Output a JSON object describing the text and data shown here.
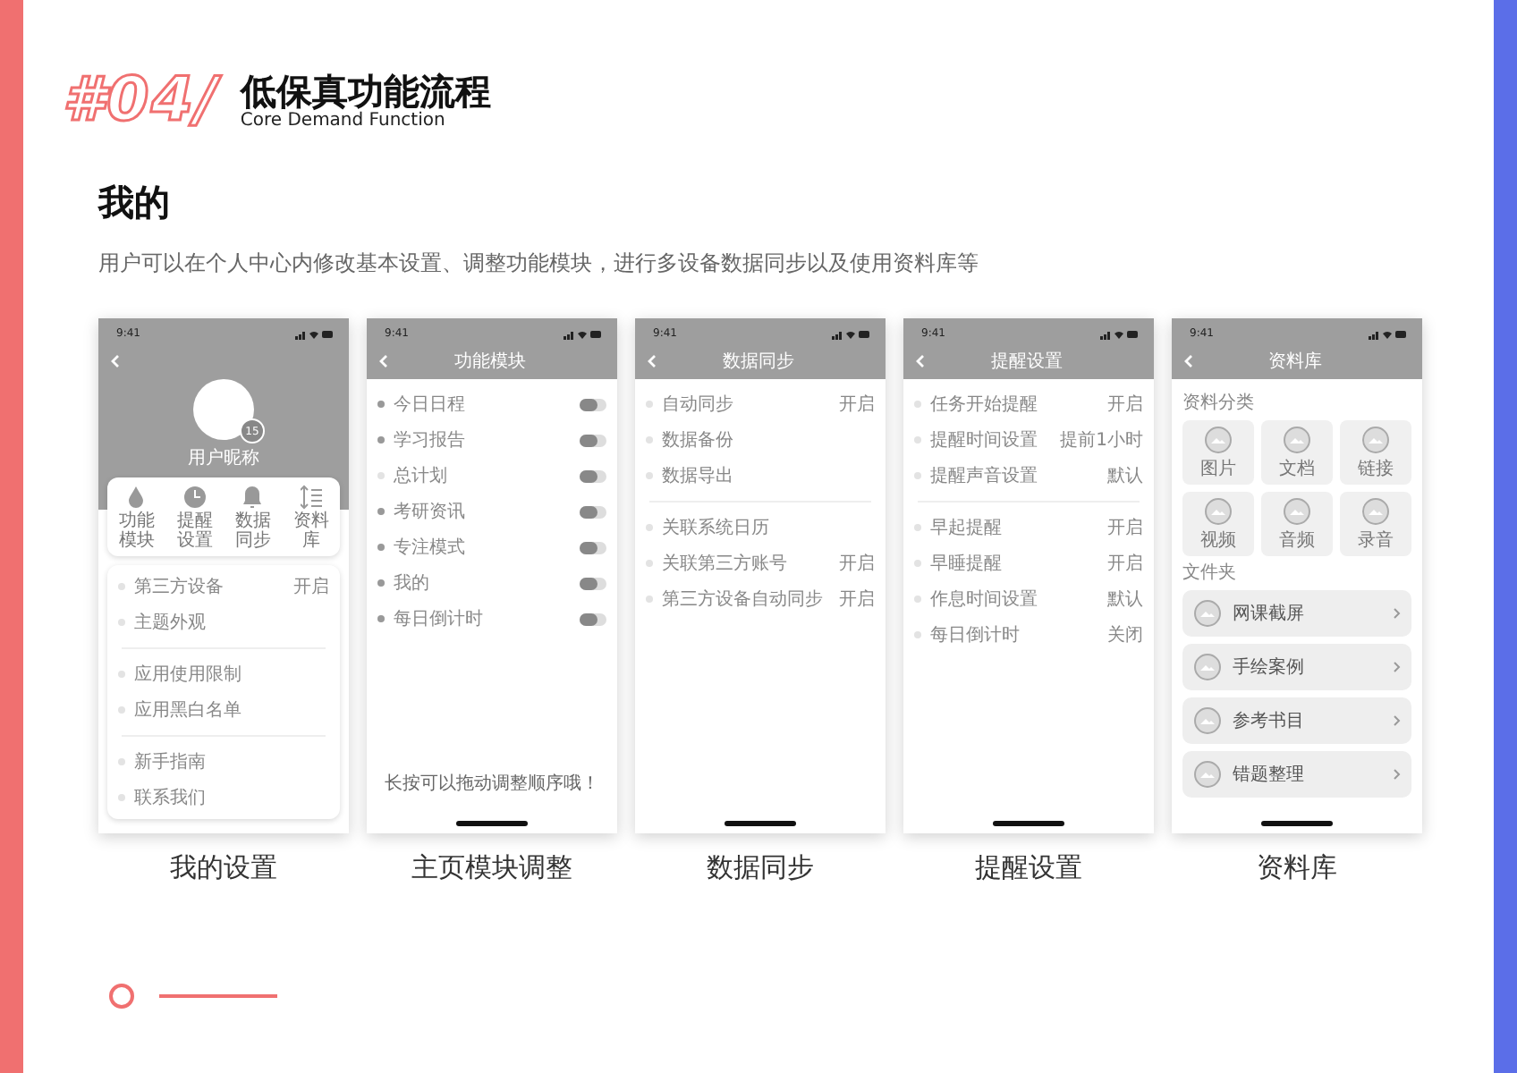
{
  "header": {
    "number": "#04/",
    "title": "低保真功能流程",
    "subtitle": "Core Demand Function"
  },
  "section": {
    "title": "我的",
    "description": "用户可以在个人中心内修改基本设置、调整功能模块，进行多设备数据同步以及使用资料库等"
  },
  "screens": [
    {
      "kind": "profile",
      "caption": "我的设置",
      "time": "9:41",
      "username": "用户昵称",
      "badge": "15",
      "shortcuts": [
        {
          "label": "功能模块"
        },
        {
          "label": "提醒设置"
        },
        {
          "label": "数据同步"
        },
        {
          "label": "资料库"
        }
      ],
      "groups": [
        {
          "items": [
            {
              "label": "第三方设备",
              "value": "开启"
            },
            {
              "label": "主题外观"
            }
          ]
        },
        {
          "items": [
            {
              "label": "应用使用限制"
            },
            {
              "label": "应用黑白名单"
            }
          ]
        },
        {
          "items": [
            {
              "label": "新手指南"
            },
            {
              "label": "联系我们"
            }
          ]
        }
      ]
    },
    {
      "kind": "toggles",
      "caption": "主页模块调整",
      "time": "9:41",
      "title": "功能模块",
      "items": [
        {
          "label": "今日日程",
          "on": false,
          "active": true
        },
        {
          "label": "学习报告",
          "on": false,
          "active": true
        },
        {
          "label": "总计划",
          "on": false,
          "active": false
        },
        {
          "label": "考研资讯",
          "on": false,
          "active": true
        },
        {
          "label": "专注模式",
          "on": false,
          "active": true
        },
        {
          "label": "我的",
          "on": false,
          "active": true
        },
        {
          "label": "每日倒计时",
          "on": false,
          "active": true
        }
      ],
      "note": "长按可以拖动调整顺序哦！"
    },
    {
      "kind": "settings",
      "caption": "数据同步",
      "time": "9:41",
      "title": "数据同步",
      "groups": [
        {
          "items": [
            {
              "label": "自动同步",
              "value": "开启"
            },
            {
              "label": "数据备份"
            },
            {
              "label": "数据导出"
            }
          ]
        },
        {
          "items": [
            {
              "label": "关联系统日历"
            },
            {
              "label": "关联第三方账号",
              "value": "开启"
            },
            {
              "label": "第三方设备自动同步",
              "value": "开启"
            }
          ]
        }
      ]
    },
    {
      "kind": "settings",
      "caption": "提醒设置",
      "time": "9:41",
      "title": "提醒设置",
      "groups": [
        {
          "items": [
            {
              "label": "任务开始提醒",
              "value": "开启"
            },
            {
              "label": "提醒时间设置",
              "value": "提前1小时"
            },
            {
              "label": "提醒声音设置",
              "value": "默认"
            }
          ]
        },
        {
          "items": [
            {
              "label": "早起提醒",
              "value": "开启"
            },
            {
              "label": "早睡提醒",
              "value": "开启"
            },
            {
              "label": "作息时间设置",
              "value": "默认"
            },
            {
              "label": "每日倒计时",
              "value": "关闭"
            }
          ]
        }
      ]
    },
    {
      "kind": "library",
      "caption": "资料库",
      "time": "9:41",
      "title": "资料库",
      "category_heading": "资料分类",
      "categories": [
        {
          "label": "图片"
        },
        {
          "label": "文档"
        },
        {
          "label": "链接"
        },
        {
          "label": "视频"
        },
        {
          "label": "音频"
        },
        {
          "label": "录音"
        }
      ],
      "folder_heading": "文件夹",
      "folders": [
        {
          "title": "网课截屏"
        },
        {
          "title": "手绘案例"
        },
        {
          "title": "参考书目"
        },
        {
          "title": "错题整理"
        }
      ]
    }
  ]
}
